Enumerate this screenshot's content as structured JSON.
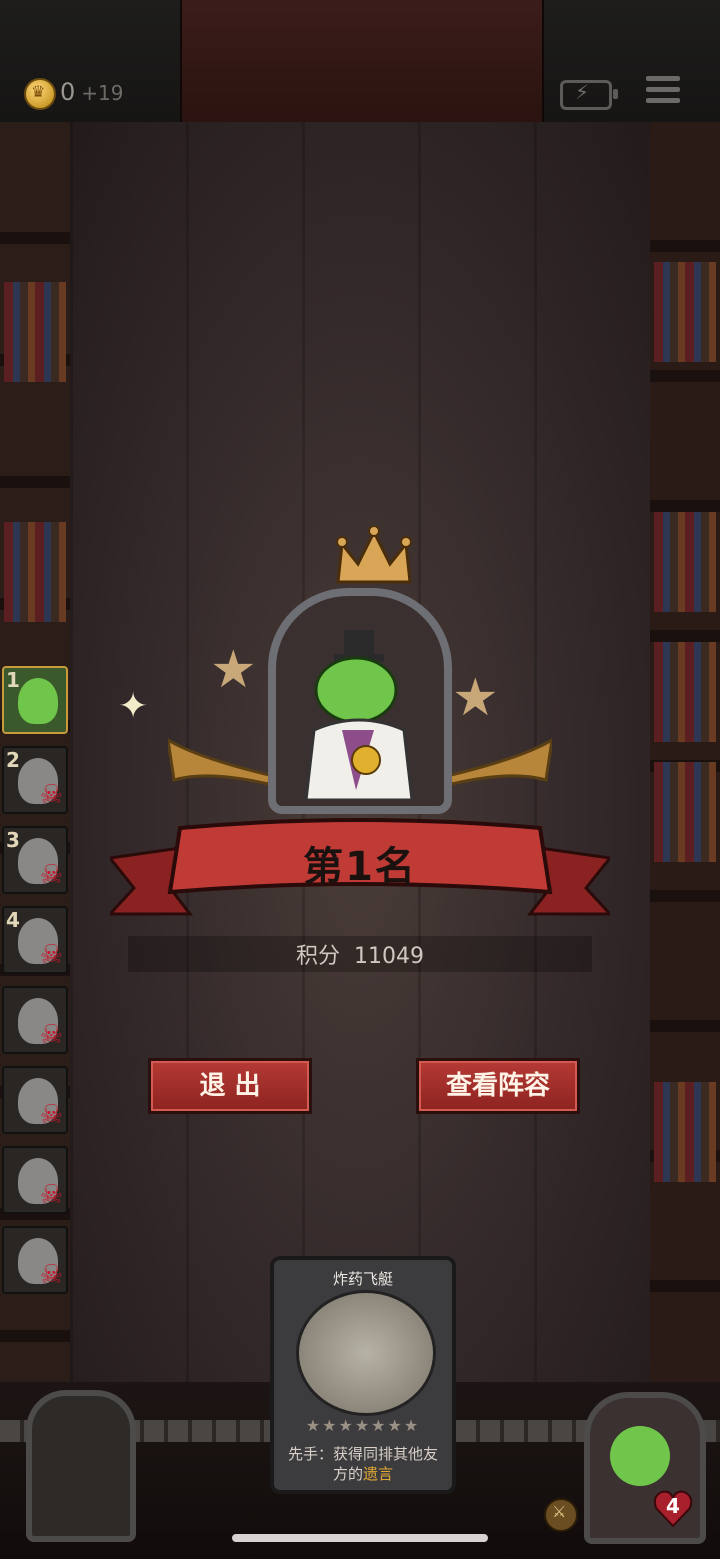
{
  "topbar": {
    "coins": "0",
    "coins_gain": "+19"
  },
  "roster": [
    {
      "rank": "1",
      "status": "alive"
    },
    {
      "rank": "2",
      "status": "dead"
    },
    {
      "rank": "3",
      "status": "dead"
    },
    {
      "rank": "4",
      "status": "dead"
    },
    {
      "rank": "",
      "status": "dead"
    },
    {
      "rank": "",
      "status": "dead"
    },
    {
      "rank": "",
      "status": "dead"
    },
    {
      "rank": "",
      "status": "dead"
    }
  ],
  "result": {
    "title": "第1名",
    "score_label": "积分",
    "score_value": "11049"
  },
  "buttons": {
    "exit": "退 出",
    "view_lineup": "查看阵容"
  },
  "card": {
    "name": "炸药飞艇",
    "stars": "★★★★★★★",
    "desc_prefix": "先手：获得同排其他友方的",
    "desc_tag": "遗言"
  },
  "player": {
    "health": "4"
  },
  "colors": {
    "accent_red": "#a82d29",
    "gold": "#c89a3c",
    "goblin_green": "#6fc64a"
  }
}
